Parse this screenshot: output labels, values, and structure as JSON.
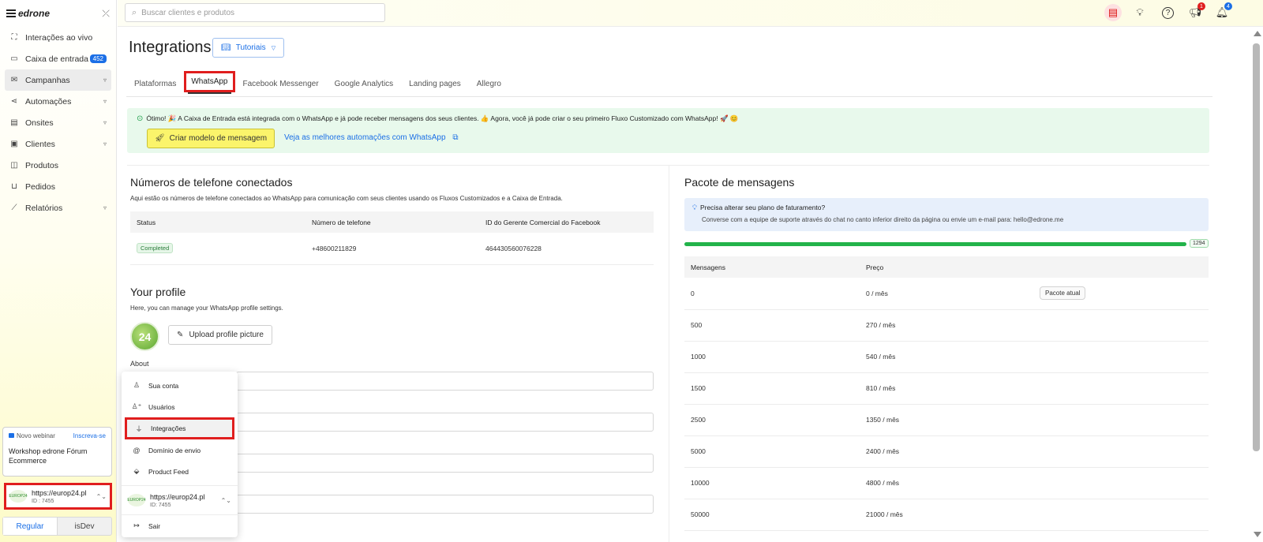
{
  "app": {
    "logo": "edrone"
  },
  "sidebar": {
    "items": [
      {
        "label": "Interações ao vivo",
        "icon": "live-icon"
      },
      {
        "label": "Caixa de entrada",
        "icon": "inbox-icon",
        "badge": "452"
      },
      {
        "label": "Campanhas",
        "icon": "campaign-icon",
        "chevron": true
      },
      {
        "label": "Automações",
        "icon": "automation-icon",
        "chevron": true
      },
      {
        "label": "Onsites",
        "icon": "onsite-icon",
        "chevron": true
      },
      {
        "label": "Clientes",
        "icon": "clients-icon",
        "chevron": true
      },
      {
        "label": "Produtos",
        "icon": "products-icon"
      },
      {
        "label": "Pedidos",
        "icon": "cart-icon"
      },
      {
        "label": "Relatórios",
        "icon": "chart-icon",
        "chevron": true
      }
    ],
    "webinar": {
      "tag": "Novo webinar",
      "cta": "Inscreva-se",
      "title": "Workshop edrone Fórum Ecommerce"
    },
    "account": {
      "url": "https://europ24.pl",
      "id": "ID : 7455",
      "logo_text": "EUROP24"
    },
    "mode": {
      "regular": "Regular",
      "dev": "isDev"
    }
  },
  "topbar": {
    "search_placeholder": "Buscar clientes e produtos",
    "badges": {
      "megaphone": "1",
      "bell": "4"
    }
  },
  "page": {
    "title": "Integrations",
    "tutorials": "Tutoriais",
    "tabs": [
      "Plataformas",
      "WhatsApp",
      "Facebook Messenger",
      "Google Analytics",
      "Landing pages",
      "Allegro"
    ],
    "banner": {
      "message": "Ótimo! 🎉 A Caixa de Entrada está integrada com o WhatsApp e já pode receber mensagens dos seus clientes. 👍 Agora, você já pode criar o seu primeiro Fluxo Customizado com WhatsApp! 🚀 😊",
      "button": "Criar modelo de mensagem",
      "link": "Veja as melhores automações com WhatsApp"
    },
    "phones": {
      "title": "Números de telefone conectados",
      "description": "Aqui estão os números de telefone conectados ao WhatsApp para comunicação com seus clientes usando os Fluxos Customizados e a Caixa de Entrada.",
      "columns": [
        "Status",
        "Número de telefone",
        "ID do Gerente Comercial do Facebook"
      ],
      "rows": [
        {
          "status": "Completed",
          "phone": "+48600211829",
          "fb_id": "464430560076228"
        }
      ]
    },
    "profile": {
      "title": "Your profile",
      "description": "Here, you can manage your WhatsApp profile settings.",
      "upload": "Upload profile picture",
      "about_label": "About",
      "avatar_text": "24"
    },
    "package": {
      "title": "Pacote de mensagens",
      "info_title": "Precisa alterar seu plano de faturamento?",
      "info_desc": "Converse com a equipe de suporte através do chat no canto inferior direito da página ou envie um e-mail para: hello@edrone.me",
      "progress_count": "1294",
      "progress_fraction": 1.0,
      "columns": [
        "Mensagens",
        "Preço"
      ],
      "current_label": "Pacote atual",
      "rows": [
        {
          "messages": "0",
          "price": "0 / mês",
          "current": true
        },
        {
          "messages": "500",
          "price": "270 / mês"
        },
        {
          "messages": "1000",
          "price": "540 / mês"
        },
        {
          "messages": "1500",
          "price": "810 / mês"
        },
        {
          "messages": "2500",
          "price": "1350 / mês"
        },
        {
          "messages": "5000",
          "price": "2400 / mês"
        },
        {
          "messages": "10000",
          "price": "4800 / mês"
        },
        {
          "messages": "50000",
          "price": "21000 / mês"
        }
      ]
    }
  },
  "dropdown": {
    "items": [
      {
        "label": "Sua conta",
        "icon": "user-icon"
      },
      {
        "label": "Usuários",
        "icon": "users-icon"
      },
      {
        "label": "Integrações",
        "icon": "plug-icon",
        "highlight": true
      },
      {
        "label": "Domínio de envio",
        "icon": "at-icon"
      },
      {
        "label": "Product Feed",
        "icon": "tag-icon"
      }
    ],
    "account": {
      "url": "https://europ24.pl",
      "id": "ID: 7455"
    },
    "logout": "Sair"
  },
  "colors": {
    "accent": "#1b6fe6",
    "highlight": "#e01e1e",
    "success": "#22b34a",
    "cta_yellow": "#fbf46b"
  }
}
